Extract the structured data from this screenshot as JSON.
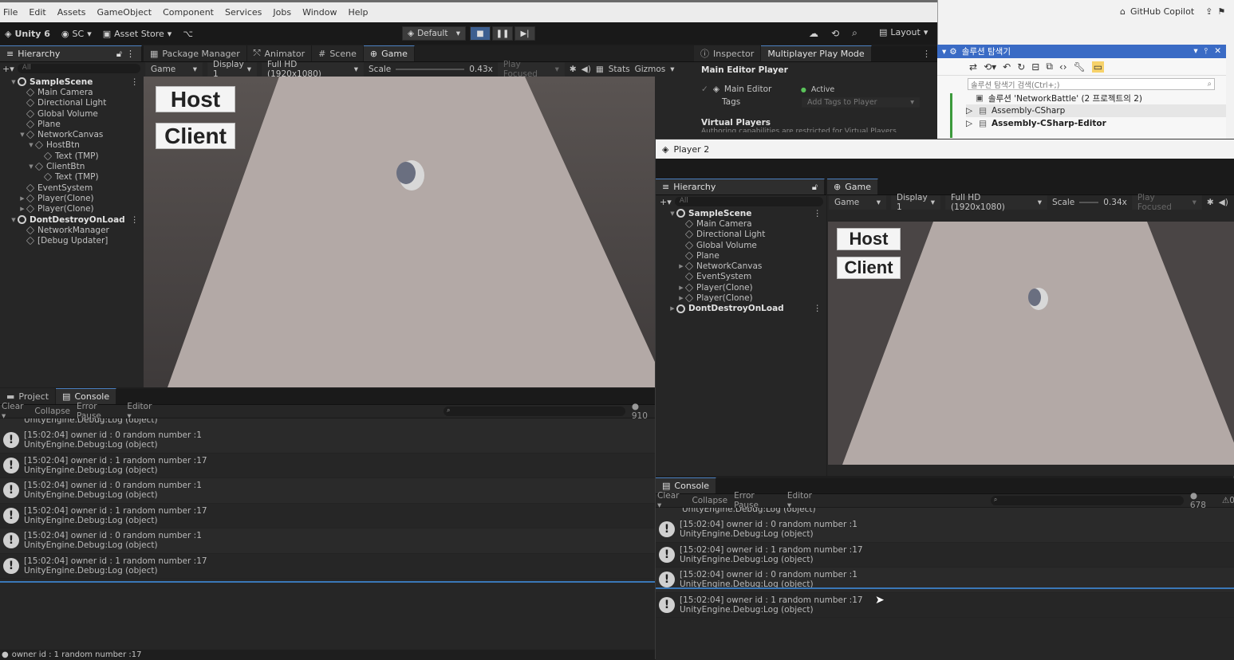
{
  "menubar": {
    "items": [
      "File",
      "Edit",
      "Assets",
      "GameObject",
      "Component",
      "Services",
      "Jobs",
      "Window",
      "Help"
    ]
  },
  "toolbar": {
    "unity_version": "Unity 6",
    "account": "SC",
    "asset_store": "Asset Store",
    "layout_preset": "Default",
    "layout": "Layout"
  },
  "main": {
    "hierarchy": {
      "tab": "Hierarchy",
      "search_placeholder": "All",
      "rows": [
        {
          "label": "SampleScene",
          "indent": 0,
          "kind": "scene",
          "expand": "▼"
        },
        {
          "label": "Main Camera",
          "indent": 1,
          "kind": "go",
          "expand": ""
        },
        {
          "label": "Directional Light",
          "indent": 1,
          "kind": "go",
          "expand": ""
        },
        {
          "label": "Global Volume",
          "indent": 1,
          "kind": "go",
          "expand": ""
        },
        {
          "label": "Plane",
          "indent": 1,
          "kind": "go",
          "expand": ""
        },
        {
          "label": "NetworkCanvas",
          "indent": 1,
          "kind": "go",
          "expand": "▼"
        },
        {
          "label": "HostBtn",
          "indent": 2,
          "kind": "go",
          "expand": "▼"
        },
        {
          "label": "Text (TMP)",
          "indent": 3,
          "kind": "go",
          "expand": ""
        },
        {
          "label": "ClientBtn",
          "indent": 2,
          "kind": "go",
          "expand": "▼"
        },
        {
          "label": "Text (TMP)",
          "indent": 3,
          "kind": "go",
          "expand": ""
        },
        {
          "label": "EventSystem",
          "indent": 1,
          "kind": "go",
          "expand": ""
        },
        {
          "label": "Player(Clone)",
          "indent": 1,
          "kind": "go",
          "expand": "▶"
        },
        {
          "label": "Player(Clone)",
          "indent": 1,
          "kind": "go",
          "expand": "▶"
        },
        {
          "label": "DontDestroyOnLoad",
          "indent": 0,
          "kind": "scene",
          "expand": "▼"
        },
        {
          "label": "NetworkManager",
          "indent": 1,
          "kind": "go",
          "expand": ""
        },
        {
          "label": "[Debug Updater]",
          "indent": 1,
          "kind": "go",
          "expand": ""
        }
      ]
    },
    "tabs": [
      "Package Manager",
      "Animator",
      "Scene",
      "Game"
    ],
    "game_bar": {
      "view": "Game",
      "display": "Display 1",
      "resolution": "Full HD (1920x1080)",
      "scale_label": "Scale",
      "scale_value": "0.43x",
      "play_focused": "Play Focused",
      "stats": "Stats",
      "gizmos": "Gizmos"
    },
    "game_buttons": {
      "host": "Host",
      "client": "Client"
    },
    "inspector": {
      "tab1": "Inspector",
      "tab2": "Multiplayer Play Mode",
      "section": "Main Editor Player",
      "player_name": "Main Editor",
      "status": "Active",
      "tags_label": "Tags",
      "tags_placeholder": "Add Tags to Player",
      "virtual": "Virtual Players",
      "virtual_note": "Authoring capabilities are restricted for Virtual Players"
    },
    "console": {
      "tab_project": "Project",
      "tab_console": "Console",
      "clear": "Clear",
      "collapse": "Collapse",
      "error_pause": "Error Pause",
      "editor": "Editor",
      "count": "910",
      "top_partial": "UnityEngine.Debug:Log (object)",
      "logs": [
        {
          "line1": "[15:02:04] owner id : 0 random number :1",
          "line2": "UnityEngine.Debug:Log (object)"
        },
        {
          "line1": "[15:02:04] owner id : 1 random number :17",
          "line2": "UnityEngine.Debug:Log (object)"
        },
        {
          "line1": "[15:02:04] owner id : 0 random number :1",
          "line2": "UnityEngine.Debug:Log (object)"
        },
        {
          "line1": "[15:02:04] owner id : 1 random number :17",
          "line2": "UnityEngine.Debug:Log (object)"
        },
        {
          "line1": "[15:02:04] owner id : 0 random number :1",
          "line2": "UnityEngine.Debug:Log (object)"
        },
        {
          "line1": "[15:02:04] owner id : 1 random number :17",
          "line2": "UnityEngine.Debug:Log (object)"
        }
      ]
    },
    "status_bar": "owner id : 1 random number :17"
  },
  "vs": {
    "copilot": "GitHub Copilot",
    "title": "솔루션 탐색기",
    "search_placeholder": "솔루션 탐색기 검색(Ctrl+;)",
    "solution": "솔루션 'NetworkBattle' (2 프로젝트의 2)",
    "projects": [
      "Assembly-CSharp",
      "Assembly-CSharp-Editor"
    ]
  },
  "player2": {
    "title": "Player 2",
    "hierarchy": {
      "tab": "Hierarchy",
      "search_placeholder": "All",
      "rows": [
        {
          "label": "SampleScene",
          "indent": 0,
          "kind": "scene",
          "expand": "▼"
        },
        {
          "label": "Main Camera",
          "indent": 1,
          "kind": "go",
          "expand": ""
        },
        {
          "label": "Directional Light",
          "indent": 1,
          "kind": "go",
          "expand": ""
        },
        {
          "label": "Global Volume",
          "indent": 1,
          "kind": "go",
          "expand": ""
        },
        {
          "label": "Plane",
          "indent": 1,
          "kind": "go",
          "expand": ""
        },
        {
          "label": "NetworkCanvas",
          "indent": 1,
          "kind": "go",
          "expand": "▶"
        },
        {
          "label": "EventSystem",
          "indent": 1,
          "kind": "go",
          "expand": ""
        },
        {
          "label": "Player(Clone)",
          "indent": 1,
          "kind": "go",
          "expand": "▶"
        },
        {
          "label": "Player(Clone)",
          "indent": 1,
          "kind": "go",
          "expand": "▶"
        },
        {
          "label": "DontDestroyOnLoad",
          "indent": 0,
          "kind": "scene",
          "expand": "▶"
        }
      ]
    },
    "game_tab": "Game",
    "game_bar": {
      "view": "Game",
      "display": "Display 1",
      "resolution": "Full HD (1920x1080)",
      "scale_label": "Scale",
      "scale_value": "0.34x",
      "play_focused": "Play Focused"
    },
    "game_buttons": {
      "host": "Host",
      "client": "Client"
    },
    "console": {
      "tab": "Console",
      "clear": "Clear",
      "collapse": "Collapse",
      "error_pause": "Error Pause",
      "editor": "Editor",
      "count": "678",
      "warn_count": "0",
      "top_partial": "UnityEngine.Debug:Log (object)",
      "logs": [
        {
          "line1": "[15:02:04] owner id : 0 random number :1",
          "line2": "UnityEngine.Debug:Log (object)"
        },
        {
          "line1": "[15:02:04] owner id : 1 random number :17",
          "line2": "UnityEngine.Debug:Log (object)"
        },
        {
          "line1": "[15:02:04] owner id : 0 random number :1",
          "line2": "UnityEngine.Debug:Log (object)"
        },
        {
          "line1": "[15:02:04] owner id : 1 random number :17",
          "line2": "UnityEngine.Debug:Log (object)"
        }
      ]
    }
  }
}
